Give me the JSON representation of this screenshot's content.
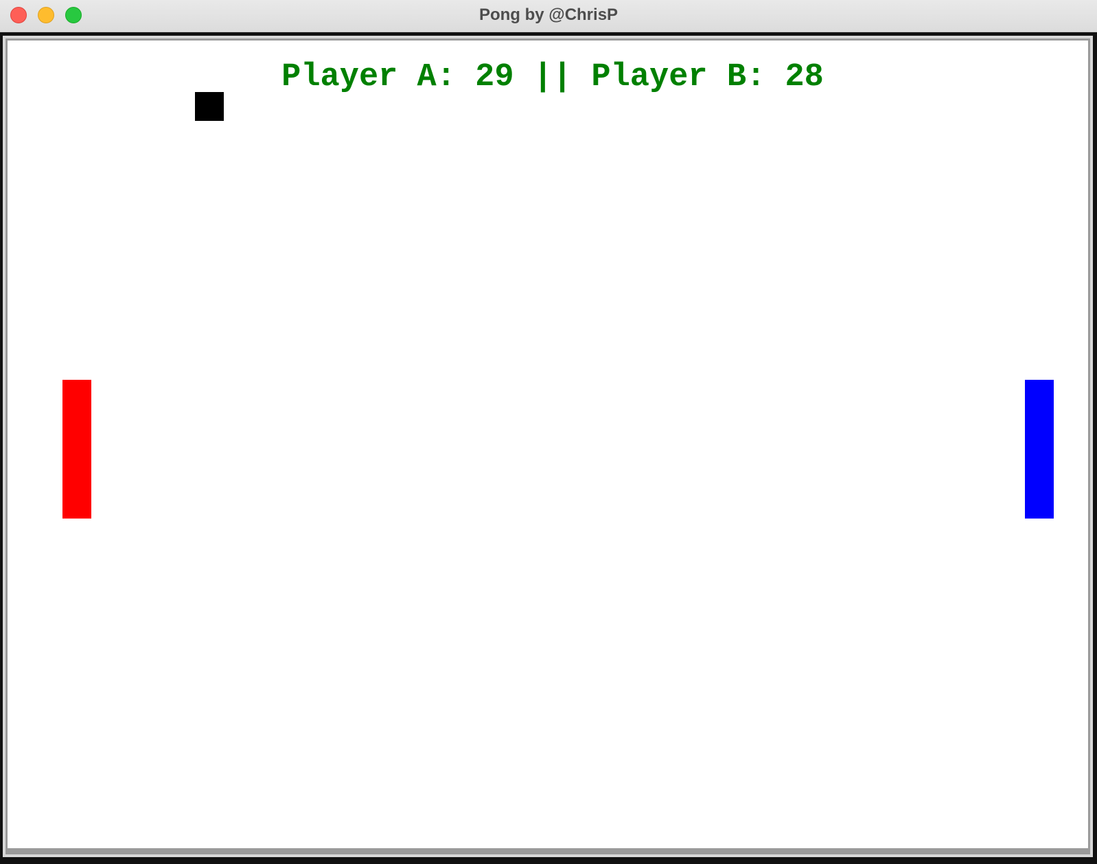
{
  "window": {
    "title": "Pong by @ChrisP",
    "controls": [
      "close",
      "minimize",
      "zoom"
    ]
  },
  "game": {
    "scoreboard": {
      "text": "Player A: 29 || Player B: 28",
      "player_a": {
        "name": "Player A",
        "score": 29
      },
      "player_b": {
        "name": "Player B",
        "score": 28
      },
      "color": "#008000"
    },
    "ball": {
      "color": "#000000"
    },
    "paddle_a": {
      "color": "#ff0000"
    },
    "paddle_b": {
      "color": "#0000ff"
    },
    "background": "#ffffff"
  }
}
